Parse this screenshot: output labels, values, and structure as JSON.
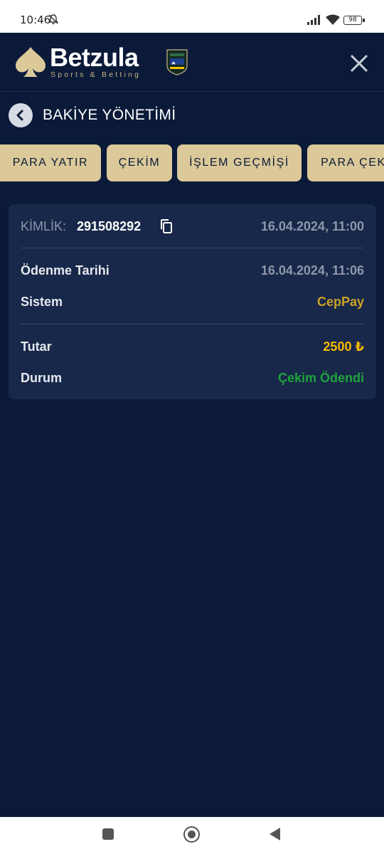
{
  "status_bar": {
    "time": "10:46",
    "battery": "98",
    "icons": [
      "bell-off-icon",
      "signal-icon",
      "wifi-icon",
      "battery-icon"
    ]
  },
  "header": {
    "brand": "Betzula",
    "brand_sub": "Sports & Betting",
    "logo_icon": "spade-icon",
    "license_badge_icon": "curacao-license-badge-icon",
    "close_icon": "close-icon"
  },
  "page": {
    "title": "BAKİYE YÖNETİMİ",
    "back_icon": "chevron-left-icon"
  },
  "tabs": [
    {
      "label": "PARA YATIR"
    },
    {
      "label": "ÇEKİM"
    },
    {
      "label": "İŞLEM GEÇMİŞİ"
    },
    {
      "label": "PARA ÇEK"
    }
  ],
  "transaction": {
    "id_label": "KİMLİK:",
    "id_value": "291508292",
    "created_at": "16.04.2024, 11:00",
    "payment_date_label": "Ödenme Tarihi",
    "payment_date_value": "16.04.2024, 11:06",
    "system_label": "Sistem",
    "system_value": "CepPay",
    "amount_label": "Tutar",
    "amount_value": "2500 ₺",
    "status_label": "Durum",
    "status_value": "Çekim Ödendi"
  },
  "colors": {
    "background": "#0b1a38",
    "card": "#18284a",
    "tab": "#dbc99a",
    "system_value": "#c9a227",
    "amount_value": "#f5b800",
    "status_value": "#1fa33a"
  },
  "nav_bar": {
    "icons": [
      "recent-apps-icon",
      "home-icon",
      "back-icon"
    ]
  }
}
